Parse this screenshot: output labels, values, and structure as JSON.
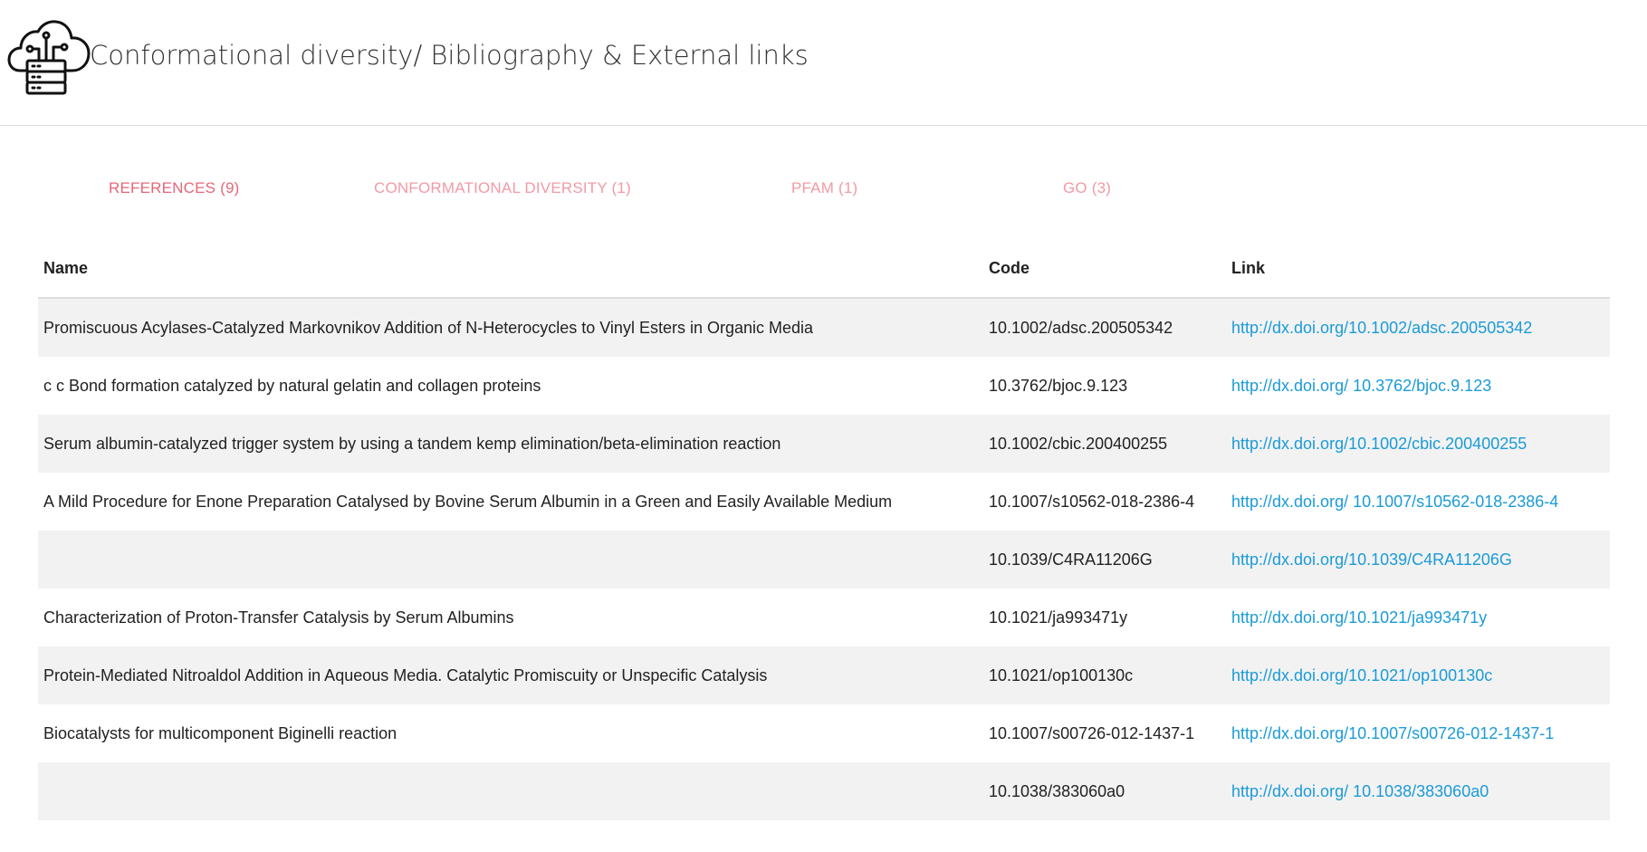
{
  "header": {
    "title": "Conformational diversity/ Bibliography & External links",
    "logo_icon": "cloud-server-icon"
  },
  "tabs": [
    {
      "label": "REFERENCES (9)",
      "active": true
    },
    {
      "label": "CONFORMATIONAL DIVERSITY (1)",
      "active": false
    },
    {
      "label": "PFAM (1)",
      "active": false
    },
    {
      "label": "GO (3)",
      "active": false
    }
  ],
  "table": {
    "columns": [
      "Name",
      "Code",
      "Link"
    ],
    "rows": [
      {
        "name": "Promiscuous Acylases-Catalyzed Markovnikov Addition of N-Heterocycles to Vinyl Esters in Organic Media",
        "code": "10.1002/adsc.200505342",
        "link": "http://dx.doi.org/10.1002/adsc.200505342"
      },
      {
        "name": "c c Bond formation catalyzed by natural gelatin and collagen proteins",
        "code": "10.3762/bjoc.9.123",
        "link": "http://dx.doi.org/ 10.3762/bjoc.9.123"
      },
      {
        "name": "Serum albumin-catalyzed trigger system by using a tandem kemp elimination/beta-elimination reaction",
        "code": "10.1002/cbic.200400255",
        "link": "http://dx.doi.org/10.1002/cbic.200400255"
      },
      {
        "name": "A Mild Procedure for Enone Preparation Catalysed by Bovine Serum Albumin in a Green and Easily Available Medium",
        "code": "10.1007/s10562-018-2386-4",
        "link": "http://dx.doi.org/ 10.1007/s10562-018-2386-4"
      },
      {
        "name": "",
        "code": "10.1039/C4RA11206G",
        "link": "http://dx.doi.org/10.1039/C4RA11206G"
      },
      {
        "name": "Characterization of Proton-Transfer Catalysis by Serum Albumins",
        "code": "10.1021/ja993471y",
        "link": "http://dx.doi.org/10.1021/ja993471y"
      },
      {
        "name": "Protein-Mediated Nitroaldol Addition in Aqueous Media. Catalytic Promiscuity or Unspecific Catalysis",
        "code": "10.1021/op100130c",
        "link": "http://dx.doi.org/10.1021/op100130c"
      },
      {
        "name": "Biocatalysts for multicomponent Biginelli reaction",
        "code": "10.1007/s00726-012-1437-1",
        "link": "http://dx.doi.org/10.1007/s00726-012-1437-1"
      },
      {
        "name": "",
        "code": "10.1038/383060a0",
        "link": "http://dx.doi.org/ 10.1038/383060a0"
      }
    ]
  },
  "colors": {
    "tab_active": "#e66778",
    "tab_inactive": "#f19aa5",
    "link": "#1a9bd7",
    "row_stripe": "#f2f2f2"
  }
}
